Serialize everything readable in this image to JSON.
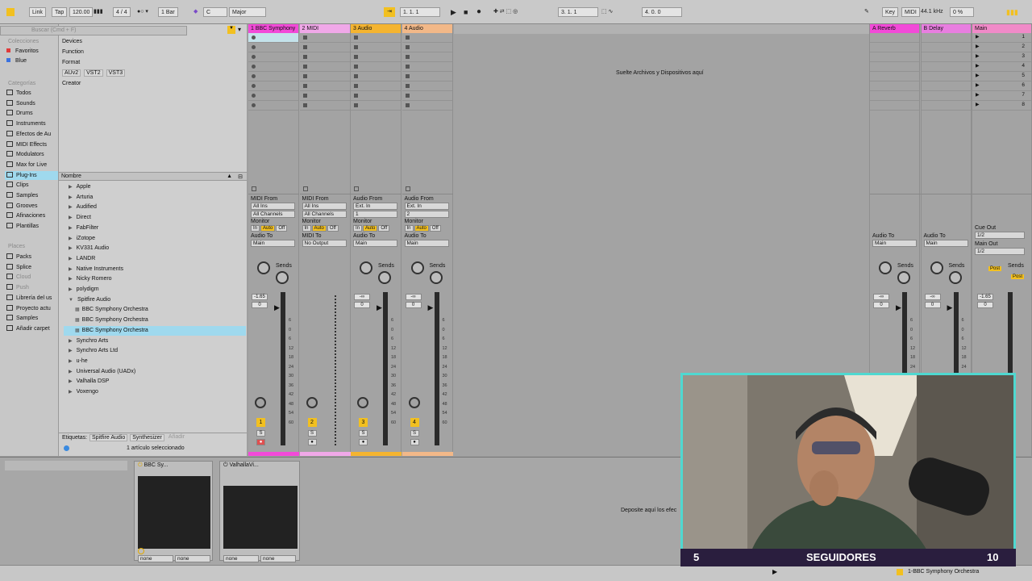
{
  "transport": {
    "link": "Link",
    "tap": "Tap",
    "tempo": "120.00",
    "signature": "4 / 4",
    "quantize": "1 Bar",
    "key": "C",
    "scale": "Major",
    "position": "1.   1.   1",
    "loop_start": "3.   1.   1",
    "loop_length": "4.   0.   0",
    "key_label": "Key",
    "midi_label": "MIDI",
    "sample_rate": "44.1 kHz",
    "cpu": "0 %"
  },
  "browser": {
    "search_placeholder": "Buscar (Cmd + F)",
    "collections_header": "Colecciones",
    "collections": [
      "Favoritos",
      "Blue"
    ],
    "collection_colors": [
      "#e03a3a",
      "#3a72e0"
    ],
    "categories_header": "Categorías",
    "categories": [
      "Todos",
      "Sounds",
      "Drums",
      "Instruments",
      "Efectos de Au",
      "MIDI Effects",
      "Modulators",
      "Max for Live",
      "Plug-Ins",
      "Clips",
      "Samples",
      "Grooves",
      "Afinaciones",
      "Plantillas"
    ],
    "places_header": "Places",
    "places": [
      "Packs",
      "Splice",
      "Cloud",
      "Push",
      "Librería del us",
      "Proyecto actu",
      "Samples",
      "Añadir carpet"
    ],
    "filters": [
      "Devices",
      "Function",
      "Format",
      "Creator"
    ],
    "formats": [
      "AUv2",
      "VST2",
      "VST3"
    ],
    "column_name": "Nombre",
    "files": [
      "Apple",
      "Arturia",
      "Audified",
      "Direct",
      "FabFilter",
      "iZotope",
      "KV331 Audio",
      "LANDR",
      "Native Instruments",
      "Nicky Romero",
      "polydigm",
      "Spitfire Audio",
      "BBC Symphony Orchestra",
      "BBC Symphony Orchestra",
      "BBC Symphony Orchestra",
      "Synchro Arts",
      "Synchro Arts Ltd",
      "u-he",
      "Universal Audio (UADx)",
      "Valhalla DSP",
      "Voxengo"
    ],
    "tags_label": "Etiquetas:",
    "tags": [
      "Spitfire Audio",
      "Synthesizer",
      "Añadir"
    ],
    "status": "1 artículo seleccionado"
  },
  "tracks": [
    {
      "name": "1 BBC Symphony",
      "color": "#f24ad8",
      "io_from": "MIDI From",
      "from1": "All Ins",
      "from2": "All Channels",
      "to_label": "Audio To",
      "to": "Main",
      "vol": "-1.65",
      "pan": "0",
      "num": "1"
    },
    {
      "name": "2 MIDI",
      "color": "#f0a8e8",
      "io_from": "MIDI From",
      "from1": "All Ins",
      "from2": "All Channels",
      "to_label": "MIDI To",
      "to": "No Output",
      "vol": "",
      "pan": "",
      "num": "2"
    },
    {
      "name": "3 Audio",
      "color": "#f4b430",
      "io_from": "Audio From",
      "from1": "Ext. In",
      "from2": "1",
      "to_label": "Audio To",
      "to": "Main",
      "vol": "-∞",
      "pan": "0",
      "num": "3"
    },
    {
      "name": "4 Audio",
      "color": "#f2b888",
      "io_from": "Audio From",
      "from1": "Ext. In",
      "from2": "2",
      "to_label": "Audio To",
      "to": "Main",
      "vol": "-∞",
      "pan": "0",
      "num": "4"
    }
  ],
  "returns": [
    {
      "name": "A Reverb",
      "color": "#f24ad8",
      "to_label": "Audio To",
      "to": "Main",
      "vol": "-∞",
      "pan": "0"
    },
    {
      "name": "B Delay",
      "color": "#e87ee0",
      "to_label": "Audio To",
      "to": "Main",
      "vol": "-∞",
      "pan": "0"
    }
  ],
  "main": {
    "name": "Main",
    "color": "#f08ac8",
    "cue_label": "Cue Out",
    "cue": "1/2",
    "main_out_label": "Main Out",
    "main_out": "1/2",
    "vol": "-1.65",
    "pan": "0",
    "scenes": [
      "1",
      "2",
      "3",
      "4",
      "5",
      "6",
      "7",
      "8"
    ]
  },
  "labels": {
    "monitor": "Monitor",
    "in": "In",
    "auto": "Auto",
    "off": "Off",
    "sends": "Sends",
    "post": "Post",
    "s": "S",
    "drop_files": "Suelte Archivos y Dispositivos aquí",
    "drop_effects": "Deposite aquí los efec"
  },
  "meter_ticks": [
    "6",
    "0",
    "6",
    "12",
    "18",
    "24",
    "30",
    "36",
    "42",
    "48",
    "54",
    "60"
  ],
  "detail": {
    "device1": "BBC Sy...",
    "device2": "ValhallaVi...",
    "none": "none",
    "status_clip": "1-BBC Symphony Orchestra"
  },
  "overlay": {
    "left_num": "5",
    "label": "SEGUIDORES",
    "right_num": "10"
  }
}
